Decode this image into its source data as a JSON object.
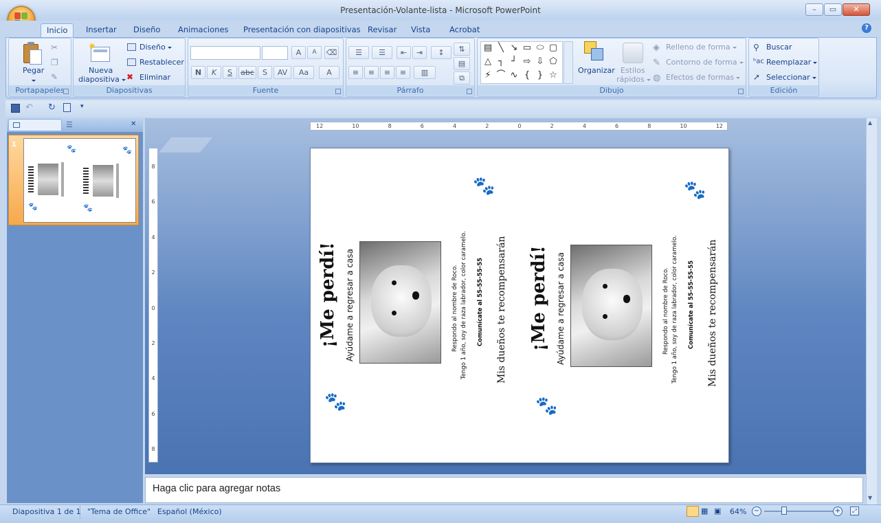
{
  "window": {
    "title": "Presentación-Volante-lista - Microsoft PowerPoint"
  },
  "tabs": [
    "Inicio",
    "Insertar",
    "Diseño",
    "Animaciones",
    "Presentación con diapositivas",
    "Revisar",
    "Vista",
    "Acrobat"
  ],
  "ribbon": {
    "portapapeles": {
      "paste_label": "Pegar",
      "group_label": "Portapapeles"
    },
    "diapositivas": {
      "new_slide_line1": "Nueva",
      "new_slide_line2": "diapositiva",
      "layout": "Diseño",
      "reset": "Restablecer",
      "delete": "Eliminar",
      "group_label": "Diapositivas"
    },
    "fuente": {
      "group_label": "Fuente",
      "bold": "N",
      "italic": "K",
      "underline": "S",
      "strike": "abc",
      "shadow": "S",
      "spacing": "AV",
      "case": "Aa",
      "color": "A",
      "grow": "A",
      "shrink": "A"
    },
    "parrafo": {
      "group_label": "Párrafo"
    },
    "dibujo": {
      "arrange": "Organizar",
      "quick_styles_line1": "Estilos",
      "quick_styles_line2": "rápidos",
      "fill": "Relleno de forma",
      "outline": "Contorno de forma",
      "effects": "Efectos de formas",
      "group_label": "Dibujo"
    },
    "edicion": {
      "find": "Buscar",
      "replace": "Reemplazar",
      "select": "Seleccionar",
      "group_label": "Edición"
    }
  },
  "slide_panel": {
    "slide_number": "1"
  },
  "ruler": {
    "horizontal_ticks": [
      "12",
      "10",
      "8",
      "6",
      "4",
      "2",
      "0",
      "2",
      "4",
      "6",
      "8",
      "10",
      "12"
    ],
    "vertical_ticks": [
      "8",
      "6",
      "4",
      "2",
      "0",
      "2",
      "4",
      "6",
      "8"
    ]
  },
  "slide": {
    "flyers": [
      {
        "headline": "¡Me perdí!",
        "subtitle": "Ayúdame a regresar a casa",
        "desc1": "Respondo al nombre de Roco.",
        "desc2": "Tengo 1 año, soy de raza labrador, color caramelo.",
        "contact": "Comunícate al 55-55-55-55",
        "reward": "Mis dueños te recompensarán"
      },
      {
        "headline": "¡Me perdí!",
        "subtitle": "Ayúdame a regresar a casa",
        "desc1": "Respondo al nombre de Roco.",
        "desc2": "Tengo 1 año, soy de raza labrador, color caramelo.",
        "contact": "Comunícate al 55-55-55-55",
        "reward": "Mis dueños te recompensarán"
      }
    ]
  },
  "notes": {
    "placeholder": "Haga clic para agregar notas"
  },
  "status": {
    "slide_info": "Diapositiva 1 de 1",
    "theme": "\"Tema de Office\"",
    "language": "Español (México)",
    "zoom": "64%"
  }
}
